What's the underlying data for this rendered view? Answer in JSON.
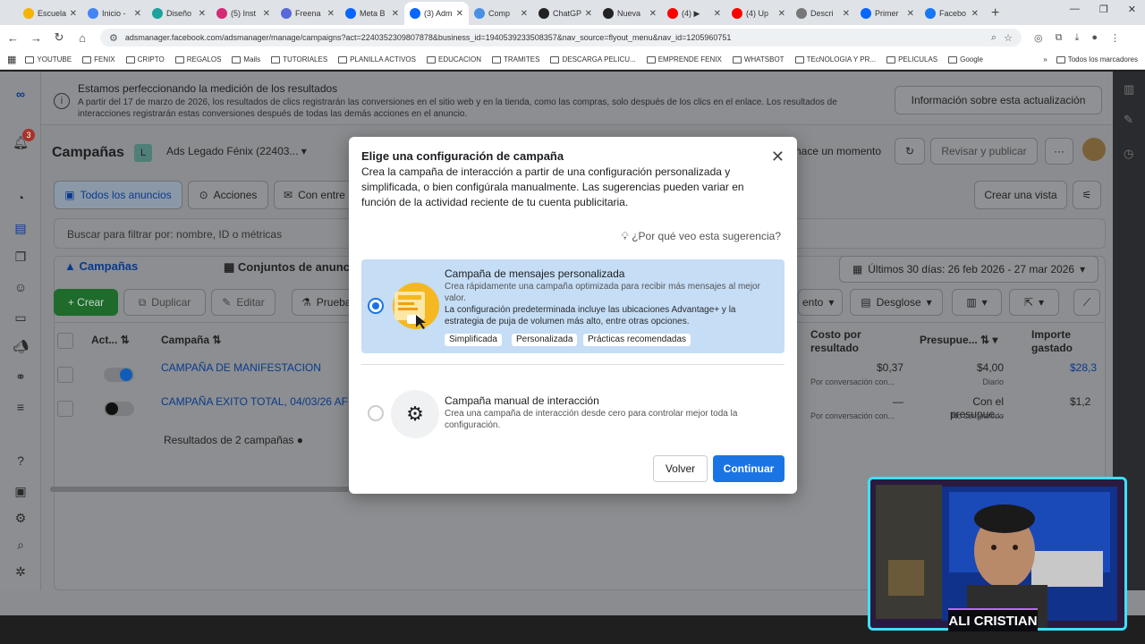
{
  "browser": {
    "tabs": [
      {
        "label": "Escuela",
        "color": "#f4b400"
      },
      {
        "label": "Inicio -",
        "color": "#4285f4"
      },
      {
        "label": "Diseño",
        "color": "#1ba39c"
      },
      {
        "label": "(5) Inst",
        "color": "#d62976"
      },
      {
        "label": "Freena",
        "color": "#5a67d8"
      },
      {
        "label": "Meta B",
        "color": "#0866ff"
      },
      {
        "label": "(3) Adm",
        "color": "#0866ff"
      },
      {
        "label": "Comp",
        "color": "#4a90e2"
      },
      {
        "label": "ChatGP",
        "color": "#222222"
      },
      {
        "label": "Nueva",
        "color": "#222222"
      },
      {
        "label": "(4) ▶",
        "color": "#ff0000"
      },
      {
        "label": "(4) Up",
        "color": "#ff0000"
      },
      {
        "label": "Descri",
        "color": "#777777"
      },
      {
        "label": "Primer",
        "color": "#0866ff"
      },
      {
        "label": "Facebo",
        "color": "#1877f2"
      }
    ],
    "url": "adsmanager.facebook.com/adsmanager/manage/campaigns?act=2240352309807878&business_id=1940539233508357&nav_source=flyout_menu&nav_id=1205960751",
    "bookmarks": [
      "YOUTUBE",
      "FENIX",
      "CRIPTO",
      "REGALOS",
      "Mails",
      "TUTORIALES",
      "PLANILLA ACTIVOS",
      "EDUCACION",
      "TRAMITES",
      "DESCARGA PELICU...",
      "EMPRENDE FENIX",
      "WHATSBOT",
      "TEcNOLOGIA Y PR...",
      "PELICULAS",
      "Google"
    ],
    "bookmarks_more": "»",
    "all_bookmarks": "Todos los marcadores"
  },
  "notice": {
    "title": "Estamos perfeccionando la medición de los resultados",
    "body": "A partir del 17 de marzo de 2026, los resultados de clics registrarán las conversiones en el sitio web y en la tienda, como las compras, solo después de los clics en el enlace. Los resultados de interacciones registrarán estas conversiones después de todas las demás acciones en el anuncio.",
    "link": "Información sobre esta actualización"
  },
  "header": {
    "title": "Campañas",
    "account_badge": "L",
    "account": "Ads Legado Fénix (22403...",
    "updated": "hace un momento",
    "review_publish": "Revisar y publicar",
    "notif_count": "3"
  },
  "filters": {
    "all_ads": "Todos los anuncios",
    "actions": "Acciones",
    "con_entre": "Con entre",
    "create_view": "Crear una vista",
    "search_placeholder": "Buscar para filtrar por: nombre, ID o métricas"
  },
  "level_tabs": {
    "campaigns": "Campañas",
    "adsets": "Conjuntos de anunc"
  },
  "date_range": "Últimos 30 días: 26 feb 2026 - 27 mar 2026",
  "actions_bar": {
    "create": "+ Crear",
    "duplicate": "Duplicar",
    "edit": "Editar",
    "test": "Prueba",
    "rendimiento": "ento",
    "breakdown": "Desglose"
  },
  "table": {
    "headers": {
      "active": "Act...",
      "campaign": "Campaña",
      "cost": "Costo por resultado",
      "budget": "Presupue...",
      "spent": "Importe gastado"
    },
    "rows": [
      {
        "name": "CAMPAÑA DE MANIFESTACION",
        "cost": "$0,37",
        "cost_sub": "Por conversación con...",
        "budget": "$4,00",
        "budget_sub": "Diario",
        "spent": "$28,3"
      },
      {
        "name": "CAMPAÑA EXITO TOTAL, 04/03/26 AF",
        "cost": "—",
        "cost_sub": "Por conversación con...",
        "budget": "Con el presupue...",
        "budget_sub": "No compartido",
        "spent": "$1,2"
      }
    ],
    "footer": "Resultados de 2 campañas"
  },
  "modal": {
    "title": "Elige una configuración de campaña",
    "description": "Crea la campaña de interacción a partir de una configuración personalizada y simplificada, o bien configúrala manualmente. Las sugerencias pueden variar en función de la actividad reciente de tu cuenta publicitaria.",
    "why_link": "¿Por qué veo esta sugerencia?",
    "option1": {
      "title": "Campaña de mensajes personalizada",
      "line1": "Crea rápidamente una campaña optimizada para recibir más mensajes al mejor valor.",
      "line2": "La configuración predeterminada incluye las ubicaciones Advantage+ y la estrategia de puja de volumen más alto, entre otras opciones.",
      "chips": [
        "Simplificada",
        "Personalizada",
        "Prácticas recomendadas"
      ],
      "selected": true
    },
    "option2": {
      "title": "Campaña manual de interacción",
      "line1": "Crea una campaña de interacción desde cero para controlar mejor toda la configuración.",
      "selected": false
    },
    "back": "Volver",
    "continue": "Continuar"
  },
  "webcam": {
    "name": "ALI CRISTIAN"
  },
  "colors": {
    "accent": "#1b74e4",
    "create_green": "#1e6b2c",
    "highlight": "#c5ddf5"
  }
}
